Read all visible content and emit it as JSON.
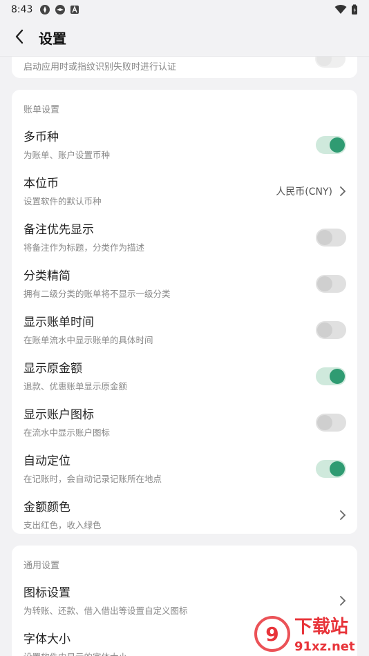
{
  "status_bar": {
    "time": "8:43"
  },
  "header": {
    "title": "设置"
  },
  "top_card": {
    "subtitle": "启动应用时或指纹识别失败时进行认证"
  },
  "bill_settings": {
    "section_title": "账单设置",
    "items": [
      {
        "title": "多币种",
        "subtitle": "为账单、账户设置币种",
        "toggle": true
      },
      {
        "title": "本位币",
        "subtitle": "设置软件的默认币种",
        "value": "人民币(CNY)"
      },
      {
        "title": "备注优先显示",
        "subtitle": "将备注作为标题，分类作为描述",
        "toggle": false
      },
      {
        "title": "分类精简",
        "subtitle": "拥有二级分类的账单将不显示一级分类",
        "toggle": false
      },
      {
        "title": "显示账单时间",
        "subtitle": "在账单流水中显示账单的具体时间",
        "toggle": false
      },
      {
        "title": "显示原金额",
        "subtitle": "退款、优惠账单显示原金额",
        "toggle": true
      },
      {
        "title": "显示账户图标",
        "subtitle": "在流水中显示账户图标",
        "toggle": false
      },
      {
        "title": "自动定位",
        "subtitle": "在记账时，会自动记录记账所在地点",
        "toggle": true
      },
      {
        "title": "金额颜色",
        "subtitle": "支出红色，收入绿色"
      }
    ]
  },
  "general_settings": {
    "section_title": "通用设置",
    "items": [
      {
        "title": "图标设置",
        "subtitle": "为转账、还款、借入借出等设置自定义图标"
      },
      {
        "title": "字体大小",
        "subtitle": "设置软件内显示的字体大小"
      }
    ]
  },
  "watermark": {
    "main": "下载站",
    "url": "91xz.net"
  },
  "colors": {
    "accent": "#2f9b72",
    "toggle_on_track": "#cfe9dc",
    "watermark": "#e8343a"
  }
}
